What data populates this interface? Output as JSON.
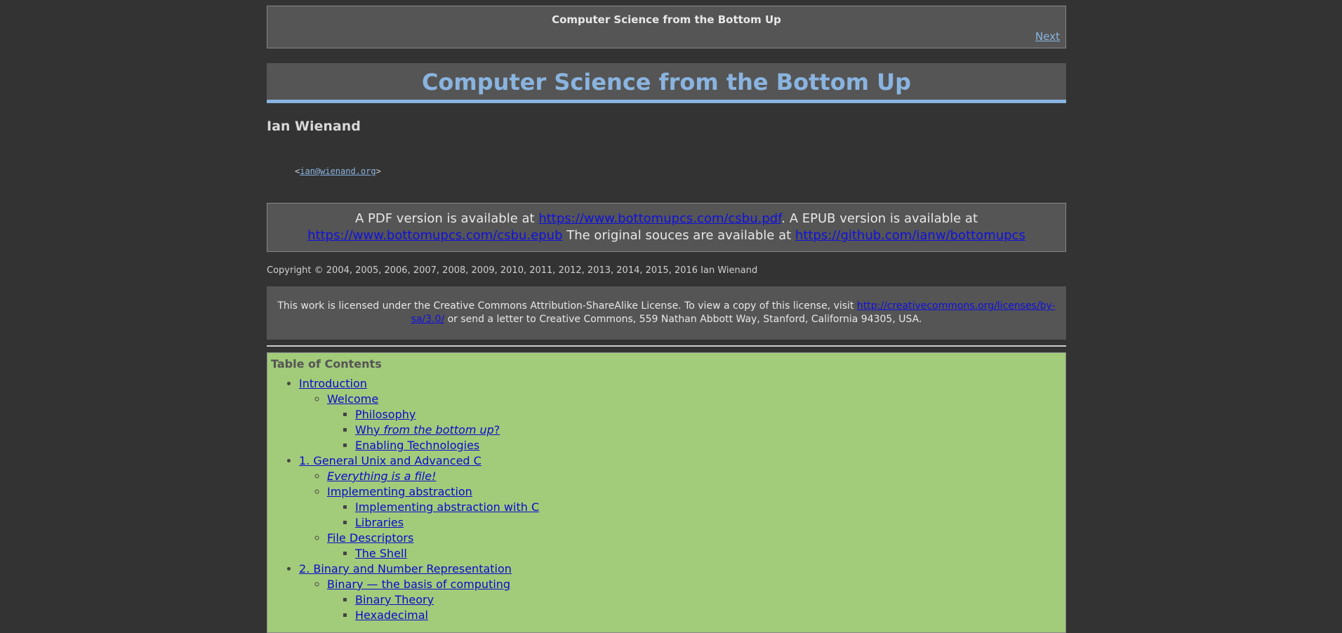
{
  "nav": {
    "title": "Computer Science from the Bottom Up",
    "next_label": "Next"
  },
  "book": {
    "title": "Computer Science from the Bottom Up",
    "author": "Ian Wienand",
    "email_open": "<",
    "email": "ian@wienand.org",
    "email_close": ">"
  },
  "availability": {
    "t1": "A PDF version is available at ",
    "pdf_url": "https://www.bottomupcs.com/csbu.pdf",
    "t2": ". A EPUB version is available at ",
    "epub_url": "https://www.bottomupcs.com/csbu.epub",
    "t3": " The original souces are available at ",
    "src_url": "https://github.com/ianw/bottomupcs"
  },
  "copyright": "Copyright © 2004, 2005, 2006, 2007, 2008, 2009, 2010, 2011, 2012, 2013, 2014, 2015, 2016 Ian Wienand",
  "license": {
    "t1": "This work is licensed under the Creative Commons Attribution-ShareAlike License. To view a copy of this license, visit ",
    "url": "http://creativecommons.org/licenses/by-sa/3.0/",
    "t2": " or send a letter to Creative Commons, 559 Nathan Abbott Way, Stanford, California 94305, USA."
  },
  "toc": {
    "title": "Table of Contents",
    "introduction": "Introduction",
    "welcome": "Welcome",
    "philosophy": "Philosophy",
    "why_prefix": "Why ",
    "why_em": "from the bottom up",
    "why_suffix": "?",
    "enabling": "Enabling Technologies",
    "ch1": "1. General Unix and Advanced C",
    "everything_file": "Everything is a file!",
    "implementing_abstraction": "Implementing abstraction",
    "implementing_abstraction_c": "Implementing abstraction with C",
    "libraries": "Libraries",
    "file_descriptors": "File Descriptors",
    "the_shell": "The Shell",
    "ch2": "2. Binary and Number Representation",
    "binary_basis": "Binary — the basis of computing",
    "binary_theory": "Binary Theory",
    "hexadecimal": "Hexadecimal"
  },
  "colors": {
    "background": "#333333",
    "panel": "#555555",
    "accent": "#8ab4e0",
    "toc_background": "#a2cb7a",
    "link": "#1010dd"
  }
}
